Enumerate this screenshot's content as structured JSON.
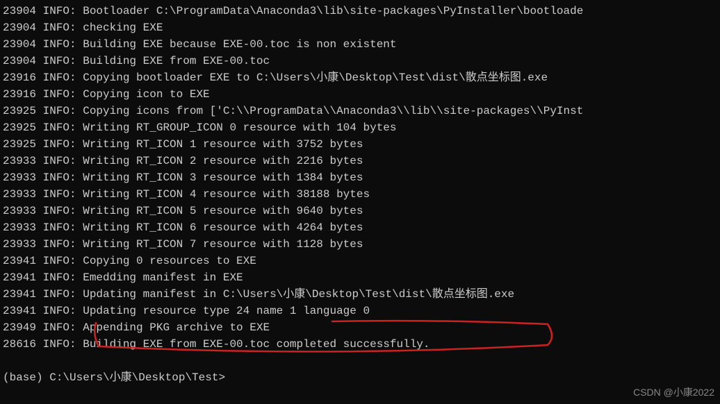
{
  "log_lines": [
    "23904 INFO: Bootloader C:\\ProgramData\\Anaconda3\\lib\\site-packages\\PyInstaller\\bootloade",
    "23904 INFO: checking EXE",
    "23904 INFO: Building EXE because EXE-00.toc is non existent",
    "23904 INFO: Building EXE from EXE-00.toc",
    "23916 INFO: Copying bootloader EXE to C:\\Users\\小康\\Desktop\\Test\\dist\\散点坐标图.exe",
    "23916 INFO: Copying icon to EXE",
    "23925 INFO: Copying icons from ['C:\\\\ProgramData\\\\Anaconda3\\\\lib\\\\site-packages\\\\PyInst",
    "23925 INFO: Writing RT_GROUP_ICON 0 resource with 104 bytes",
    "23925 INFO: Writing RT_ICON 1 resource with 3752 bytes",
    "23933 INFO: Writing RT_ICON 2 resource with 2216 bytes",
    "23933 INFO: Writing RT_ICON 3 resource with 1384 bytes",
    "23933 INFO: Writing RT_ICON 4 resource with 38188 bytes",
    "23933 INFO: Writing RT_ICON 5 resource with 9640 bytes",
    "23933 INFO: Writing RT_ICON 6 resource with 4264 bytes",
    "23933 INFO: Writing RT_ICON 7 resource with 1128 bytes",
    "23941 INFO: Copying 0 resources to EXE",
    "23941 INFO: Emedding manifest in EXE",
    "23941 INFO: Updating manifest in C:\\Users\\小康\\Desktop\\Test\\dist\\散点坐标图.exe",
    "23941 INFO: Updating resource type 24 name 1 language 0",
    "23949 INFO: Appending PKG archive to EXE",
    "28616 INFO: Building EXE from EXE-00.toc completed successfully."
  ],
  "prompt": "(base) C:\\Users\\小康\\Desktop\\Test>",
  "watermark": "CSDN @小康2022"
}
